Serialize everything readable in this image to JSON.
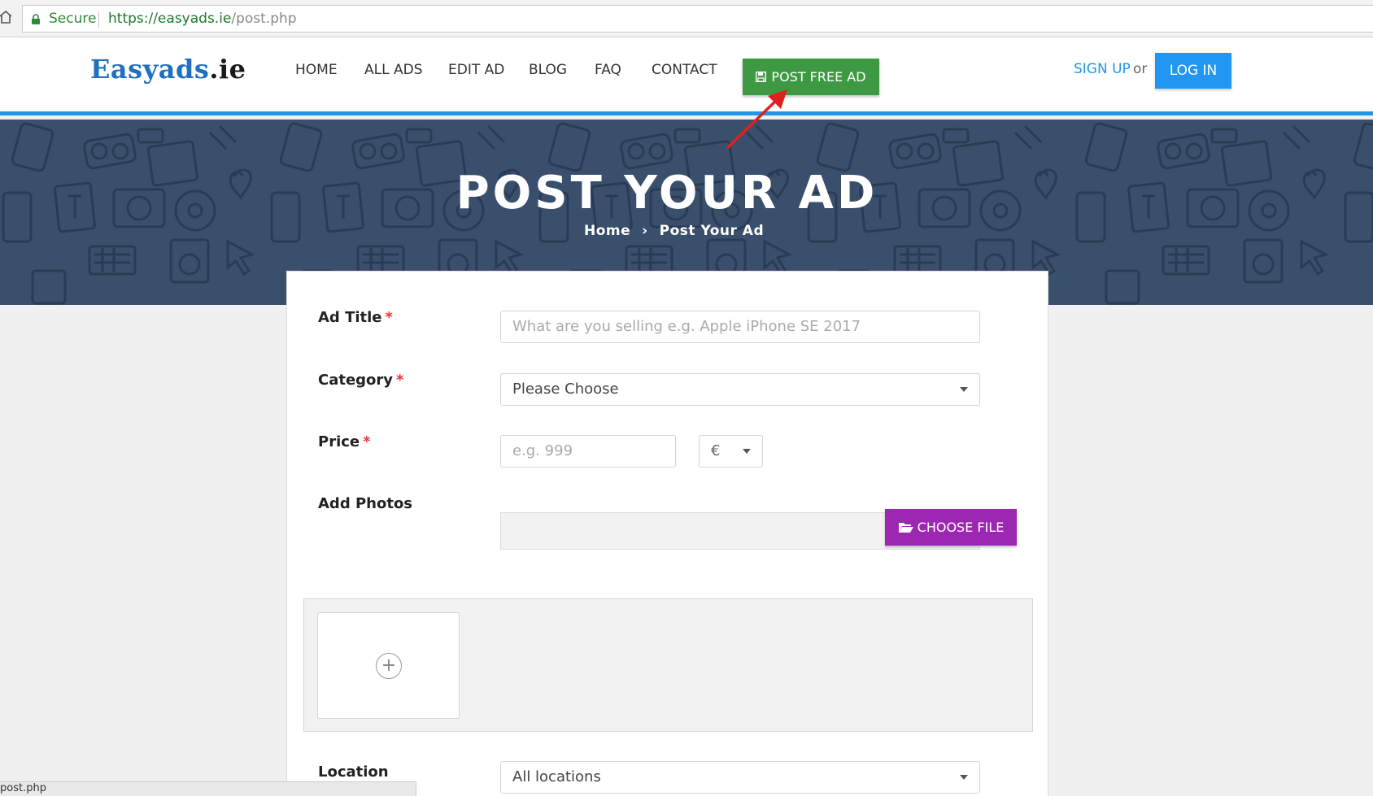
{
  "browser": {
    "secure_label": "Secure",
    "url_base": "https://easyads.ie",
    "url_path": "/post.php"
  },
  "header": {
    "logo_main": "Easyads",
    "logo_tld": ".ie",
    "nav": [
      "HOME",
      "ALL ADS",
      "EDIT AD",
      "BLOG",
      "FAQ",
      "CONTACT"
    ],
    "post_button": "POST FREE AD",
    "signup": "SIGN UP",
    "or": "or",
    "login": "LOG IN"
  },
  "hero": {
    "title": "POST YOUR AD",
    "breadcrumb_home": "Home",
    "breadcrumb_sep": "›",
    "breadcrumb_current": "Post Your Ad"
  },
  "form": {
    "ad_title_label": "Ad Title",
    "ad_title_placeholder": "What are you selling e.g. Apple iPhone SE 2017",
    "category_label": "Category",
    "category_value": "Please Choose",
    "price_label": "Price",
    "price_placeholder": "e.g. 999",
    "currency_value": "€",
    "photos_label": "Add Photos",
    "choose_file": "CHOOSE FILE",
    "add_photo_plus": "+",
    "location_label": "Location",
    "location_value": "All locations",
    "required_mark": "*"
  },
  "statusbar": {
    "text": "post.php"
  },
  "colors": {
    "brand_blue": "#2196e8",
    "post_green": "#3d9a42",
    "choose_purple": "#9c27b0",
    "hero_bg": "#3a4f6c",
    "required_red": "#e53935"
  }
}
